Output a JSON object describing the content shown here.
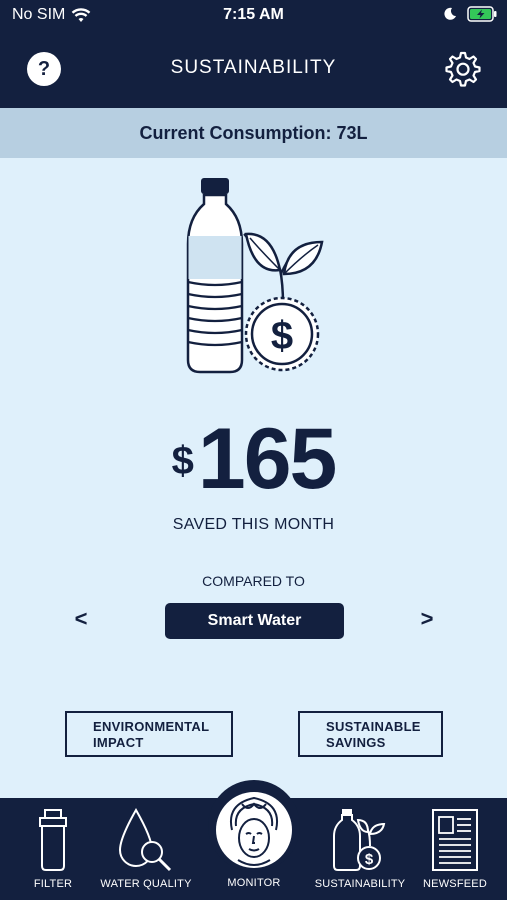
{
  "status_bar": {
    "carrier": "No SIM",
    "time": "7:15 AM"
  },
  "header": {
    "title": "SUSTAINABILITY",
    "help_label": "?"
  },
  "consumption": {
    "text": "Current Consumption: 73L"
  },
  "savings": {
    "currency": "$",
    "amount": "165",
    "caption": "SAVED THIS MONTH"
  },
  "comparison": {
    "label": "COMPARED TO",
    "prev": "<",
    "next": ">",
    "selected": "Smart Water"
  },
  "actions": {
    "environmental": "ENVIRONMENTAL\nIMPACT",
    "sustainable": "SUSTAINABLE\nSAVINGS"
  },
  "tabs": [
    {
      "label": "FILTER",
      "icon": "filter-icon"
    },
    {
      "label": "WATER QUALITY",
      "icon": "water-quality-icon"
    },
    {
      "label": "MONITOR",
      "icon": "monitor-avatar-icon"
    },
    {
      "label": "SUSTAINABILITY",
      "icon": "sustainability-icon"
    },
    {
      "label": "NEWSFEED",
      "icon": "newsfeed-icon"
    }
  ],
  "colors": {
    "navy": "#13203f",
    "background": "#dff0fb",
    "banner": "#b7cfe1",
    "battery": "#34c759"
  }
}
